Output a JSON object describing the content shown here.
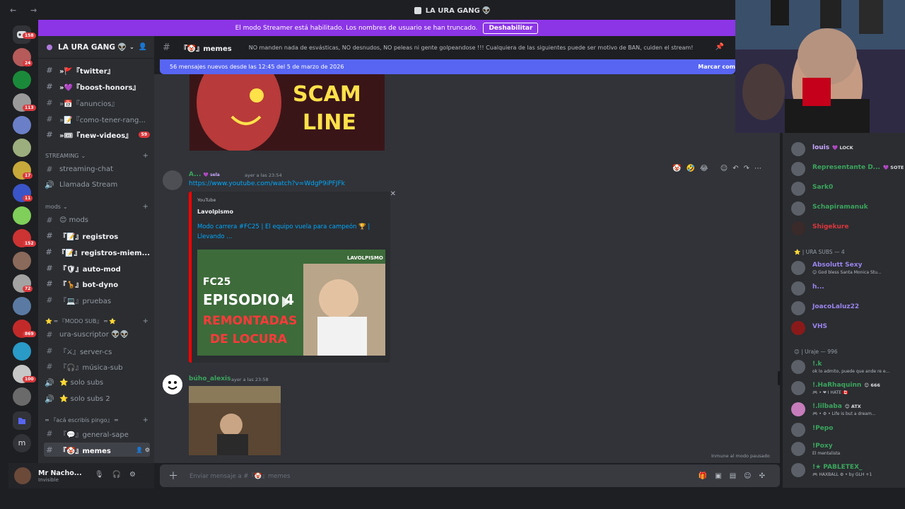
{
  "window": {
    "title": "LA URA GANG",
    "title_emoji": "👽",
    "nav": "← →"
  },
  "banner": {
    "text": "El modo Streamer está habilitado. Los nombres de usuario se han truncado.",
    "button": "Deshabilitar",
    "color": "#8c35e6"
  },
  "server_rail": {
    "badges": [
      "158",
      "24",
      "113",
      "17",
      "11",
      "152",
      "72",
      "869",
      "100"
    ]
  },
  "server": {
    "name": "LA URA GANG",
    "emoji": "👽"
  },
  "sidebar": {
    "channels_top": [
      {
        "label": "»🚩『twitter』",
        "bold": true
      },
      {
        "label": "»💜『boost-honors』",
        "bold": true
      },
      {
        "label": "»📅『anuncios』",
        "bold": false
      },
      {
        "label": "»📝『como-tener-rang...",
        "bold": false
      },
      {
        "label": "»🎟『new-videos』",
        "bold": true,
        "badge": "59"
      }
    ],
    "cat_streaming": "STREAMING",
    "streaming_channels": [
      {
        "label": "streaming-chat",
        "type": "text"
      },
      {
        "label": "Llamada Stream",
        "type": "voice"
      }
    ],
    "cat_mods": "mods",
    "mods_channels": [
      {
        "label": "😊 mods",
        "bold": false
      },
      {
        "label": "『📝』registros",
        "bold": true
      },
      {
        "label": "『📝』registros-miem...",
        "bold": true
      },
      {
        "label": "『🛡』auto-mod",
        "bold": true
      },
      {
        "label": "『🦒』bot-dyno",
        "bold": true
      },
      {
        "label": "『💻』pruebas",
        "bold": false
      }
    ],
    "cat_sub": "⭐ ═ 『MODO SUB』 ═ ⭐",
    "sub_channels": [
      {
        "label": "ura-suscriptor 👽👽",
        "type": "text"
      },
      {
        "label": "『⚔』server-cs",
        "type": "text"
      },
      {
        "label": "『🎧』música-sub",
        "type": "text"
      },
      {
        "label": "⭐ solo subs",
        "type": "voice"
      },
      {
        "label": "⭐ solo subs 2",
        "type": "voice"
      }
    ],
    "cat_pingo": "═ 『acá escribís pingo』 ═",
    "pingo_channels": [
      {
        "label": "『💬』general-sape",
        "active": false
      },
      {
        "label": "『🤡』memes",
        "active": true
      }
    ]
  },
  "user_panel": {
    "name": "Mr Nacho...",
    "status": "Invisible"
  },
  "channel_header": {
    "name": "『🤡』memes",
    "topic": "NO manden nada de esvásticas, NO desnudos, NO peleas ni gente golpeandose !!! Cualquiera de las siguientes puede ser motivo de BAN, cuiden el stream!"
  },
  "new_messages_bar": {
    "text": "56 mensajes nuevos desde las 12:45 del 5 de marzo de 2026",
    "mark": "Marcar com"
  },
  "messages": [
    {
      "author": "A...",
      "author_badge": "💜 sela",
      "time": "ayer a las 23:54",
      "link": "https://www.youtube.com/watch?v=WdgP9iPFJFk",
      "embed": {
        "provider": "YouTube",
        "author": "Lavolpismo",
        "title": "Modo carrera #FC25 | El equipo vuela para campeón 🏆 | Llevando ...",
        "thumb_text_1": "FC25",
        "thumb_text_2": "EPISODIO 4",
        "thumb_text_3": "REMONTADAS",
        "thumb_text_4": "DE LOCURA",
        "thumb_tag": "LAVOLPISMO"
      }
    },
    {
      "author": "búho_alexis",
      "time": "ayer a las 23:58"
    }
  ],
  "scam_thumb_text": {
    "line1": "SCAM",
    "line2": "LINE"
  },
  "paused_note": "Inmune al modo pausado",
  "composer": {
    "placeholder": "Enviar mensaje a #『🤡』memes"
  },
  "members": {
    "top": [
      {
        "name": "louis",
        "badge": "💜 LOCK",
        "color": "#c9a7ff"
      },
      {
        "name": "Representante D...",
        "badge": "💜 SOTE",
        "color": "#3ba55d"
      },
      {
        "name": "Sark0",
        "badge": "",
        "color": "#3ba55d"
      },
      {
        "name": "Schapiramanuk",
        "badge": "",
        "color": "#3ba55d"
      },
      {
        "name": "Shigekure",
        "badge": "",
        "color": "#da373c"
      }
    ],
    "subs_header": "⭐ | URA SUBS — 4",
    "subs": [
      {
        "name": "Absolutt Sexy",
        "status": "😊 God bless Santa Monica Stu...",
        "color": "#9b84ee"
      },
      {
        "name": "h...",
        "status": "",
        "color": "#9b84ee"
      },
      {
        "name": "JoacoLaluz22",
        "status": "",
        "color": "#9b84ee"
      },
      {
        "name": "VHS",
        "status": "",
        "color": "#9b84ee"
      }
    ],
    "uraje_header": "😊 | Uraje — 996",
    "uraje": [
      {
        "name": "!.k",
        "status": "ok lo admito, puede que ande re e...",
        "color": "#3ba55d",
        "badge": ""
      },
      {
        "name": "!.HaRhaquinn",
        "status": "🎮 • ❤ I HATE 🇨🇦",
        "color": "#3ba55d",
        "badge": "😊 666"
      },
      {
        "name": "!.lilbaba",
        "status": "🎮 • ⚙ • Life is but a dream...",
        "color": "#3ba55d",
        "badge": "😊 ATX"
      },
      {
        "name": "!Pepo",
        "status": "",
        "color": "#3ba55d",
        "badge": ""
      },
      {
        "name": "!Poxy",
        "status": "El mentalista",
        "color": "#3ba55d",
        "badge": ""
      },
      {
        "name": "!★ PABLETEX_",
        "status": "🎮 HAXBALL ⚙ • by GLH +1",
        "color": "#3ba55d",
        "badge": ""
      }
    ]
  }
}
